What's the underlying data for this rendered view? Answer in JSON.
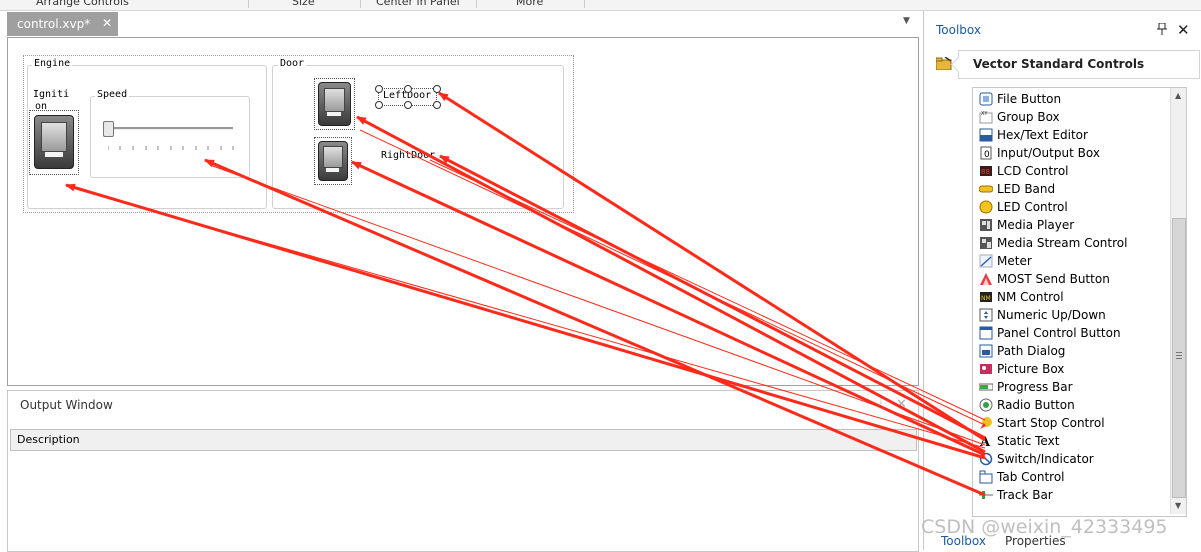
{
  "menu": {
    "items": [
      "Arrange Controls",
      "Size",
      "Center in Panel",
      "More"
    ]
  },
  "document": {
    "tab_label": "control.xvp*",
    "close_glyph": "✕",
    "overflow_glyph": "▼"
  },
  "panel": {
    "engine_group": "Engine",
    "ignition_label_line1": "Igniti",
    "ignition_label_line2": "on",
    "speed_group": "Speed",
    "door_group": "Door",
    "left_door_label": "LeftDoor",
    "right_door_label": "RightDoor"
  },
  "output": {
    "title": "Output Window",
    "pin_glyph": "📌",
    "close_glyph": "✕",
    "column_description": "Description"
  },
  "toolbox": {
    "title": "Toolbox",
    "pin_glyph": "📌",
    "close_glyph": "✕",
    "category": "Vector Standard Controls",
    "items": [
      {
        "label": "File Button",
        "icon": "file-button-icon"
      },
      {
        "label": "Group Box",
        "icon": "group-box-icon"
      },
      {
        "label": "Hex/Text Editor",
        "icon": "hex-editor-icon"
      },
      {
        "label": "Input/Output Box",
        "icon": "io-box-icon"
      },
      {
        "label": "LCD Control",
        "icon": "lcd-icon"
      },
      {
        "label": "LED Band",
        "icon": "led-band-icon"
      },
      {
        "label": "LED Control",
        "icon": "led-icon"
      },
      {
        "label": "Media Player",
        "icon": "media-player-icon"
      },
      {
        "label": "Media Stream Control",
        "icon": "media-stream-icon"
      },
      {
        "label": "Meter",
        "icon": "meter-icon"
      },
      {
        "label": "MOST Send Button",
        "icon": "most-send-icon"
      },
      {
        "label": "NM Control",
        "icon": "nm-control-icon"
      },
      {
        "label": "Numeric Up/Down",
        "icon": "numeric-updown-icon"
      },
      {
        "label": "Panel Control Button",
        "icon": "panel-control-icon"
      },
      {
        "label": "Path Dialog",
        "icon": "path-dialog-icon"
      },
      {
        "label": "Picture Box",
        "icon": "picture-box-icon"
      },
      {
        "label": "Progress Bar",
        "icon": "progress-bar-icon"
      },
      {
        "label": "Radio Button",
        "icon": "radio-button-icon"
      },
      {
        "label": "Start Stop Control",
        "icon": "start-stop-icon"
      },
      {
        "label": "Static Text",
        "icon": "static-text-icon"
      },
      {
        "label": "Switch/Indicator",
        "icon": "switch-indicator-icon"
      },
      {
        "label": "Tab Control",
        "icon": "tab-control-icon"
      },
      {
        "label": "Track Bar",
        "icon": "track-bar-icon"
      }
    ],
    "bottom_tabs": [
      "Toolbox",
      "Properties"
    ]
  },
  "watermark": "CSDN @weixin_42333495",
  "colors": {
    "arrow": "#ff2a1a",
    "accent": "#1e5aa0"
  }
}
